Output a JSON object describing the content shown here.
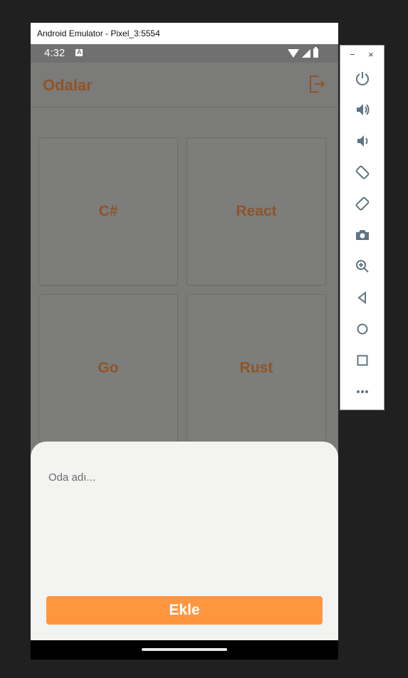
{
  "emulator": {
    "title": "Android Emulator - Pixel_3:5554"
  },
  "statusbar": {
    "time": "4:32"
  },
  "appbar": {
    "title": "Odalar",
    "logout_icon": "logout-icon"
  },
  "rooms": [
    "C#",
    "React",
    "Go",
    "Rust",
    ""
  ],
  "sheet": {
    "input_placeholder": "Oda adı...",
    "button_label": "Ekle"
  },
  "colors": {
    "accent": "#fe9640",
    "title_text": "#8f5427",
    "toolbar_icon": "#5f7482"
  },
  "toolbar": {
    "minimize": "−",
    "close": "×",
    "icons": [
      "power-icon",
      "volume-up-icon",
      "volume-down-icon",
      "rotate-left-icon",
      "rotate-right-icon",
      "camera-icon",
      "zoom-icon",
      "back-icon",
      "home-icon",
      "overview-icon",
      "more-icon"
    ]
  }
}
